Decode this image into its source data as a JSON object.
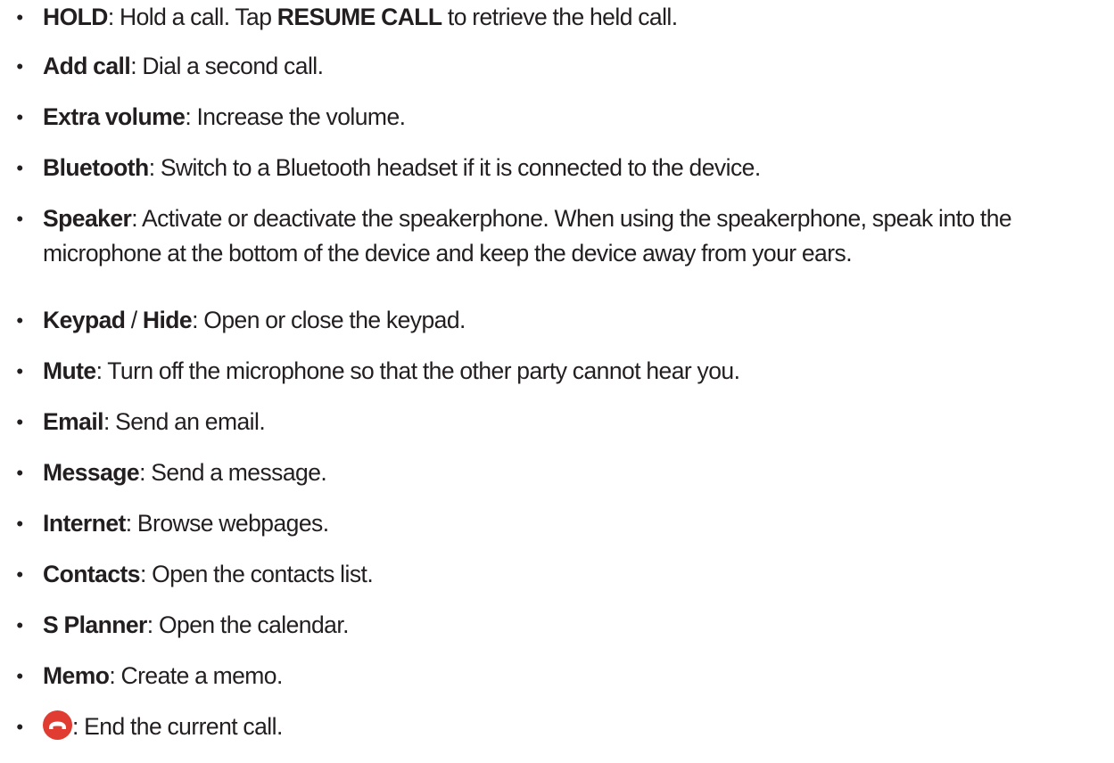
{
  "items": [
    {
      "term": "HOLD",
      "sep": ": ",
      "desc_a": "Hold a call. Tap ",
      "term2": "RESUME CALL",
      "desc_b": " to retrieve the held call."
    },
    {
      "term": "Add call",
      "sep": ": ",
      "desc": "Dial a second call."
    },
    {
      "term": "Extra volume",
      "sep": ": ",
      "desc": "Increase the volume."
    },
    {
      "term": "Bluetooth",
      "sep": ": ",
      "desc": "Switch to a Bluetooth headset if it is connected to the device."
    },
    {
      "term": "Speaker",
      "sep": ": ",
      "desc": "Activate or deactivate the speakerphone. When using the speakerphone, speak into the microphone at the bottom of the device and keep the device away from your ears."
    },
    {
      "term": "Keypad",
      "mid": " / ",
      "term2": "Hide",
      "sep": ": ",
      "desc": "Open or close the keypad."
    },
    {
      "term": "Mute",
      "sep": ": ",
      "desc": "Turn off the microphone so that the other party cannot hear you."
    },
    {
      "term": "Email",
      "sep": ": ",
      "desc": "Send an email."
    },
    {
      "term": "Message",
      "sep": ": ",
      "desc": "Send a message."
    },
    {
      "term": "Internet",
      "sep": ": ",
      "desc": "Browse webpages."
    },
    {
      "term": "Contacts",
      "sep": ": ",
      "desc": "Open the contacts list."
    },
    {
      "term": "S Planner",
      "sep": ": ",
      "desc": "Open the calendar."
    },
    {
      "term": "Memo",
      "sep": ": ",
      "desc": "Create a memo."
    },
    {
      "icon": "end-call-icon",
      "sep": ": ",
      "desc": "End the current call."
    }
  ],
  "bullet_char": "•",
  "colors": {
    "text": "#231f20",
    "end_call_red": "#e03c31"
  }
}
